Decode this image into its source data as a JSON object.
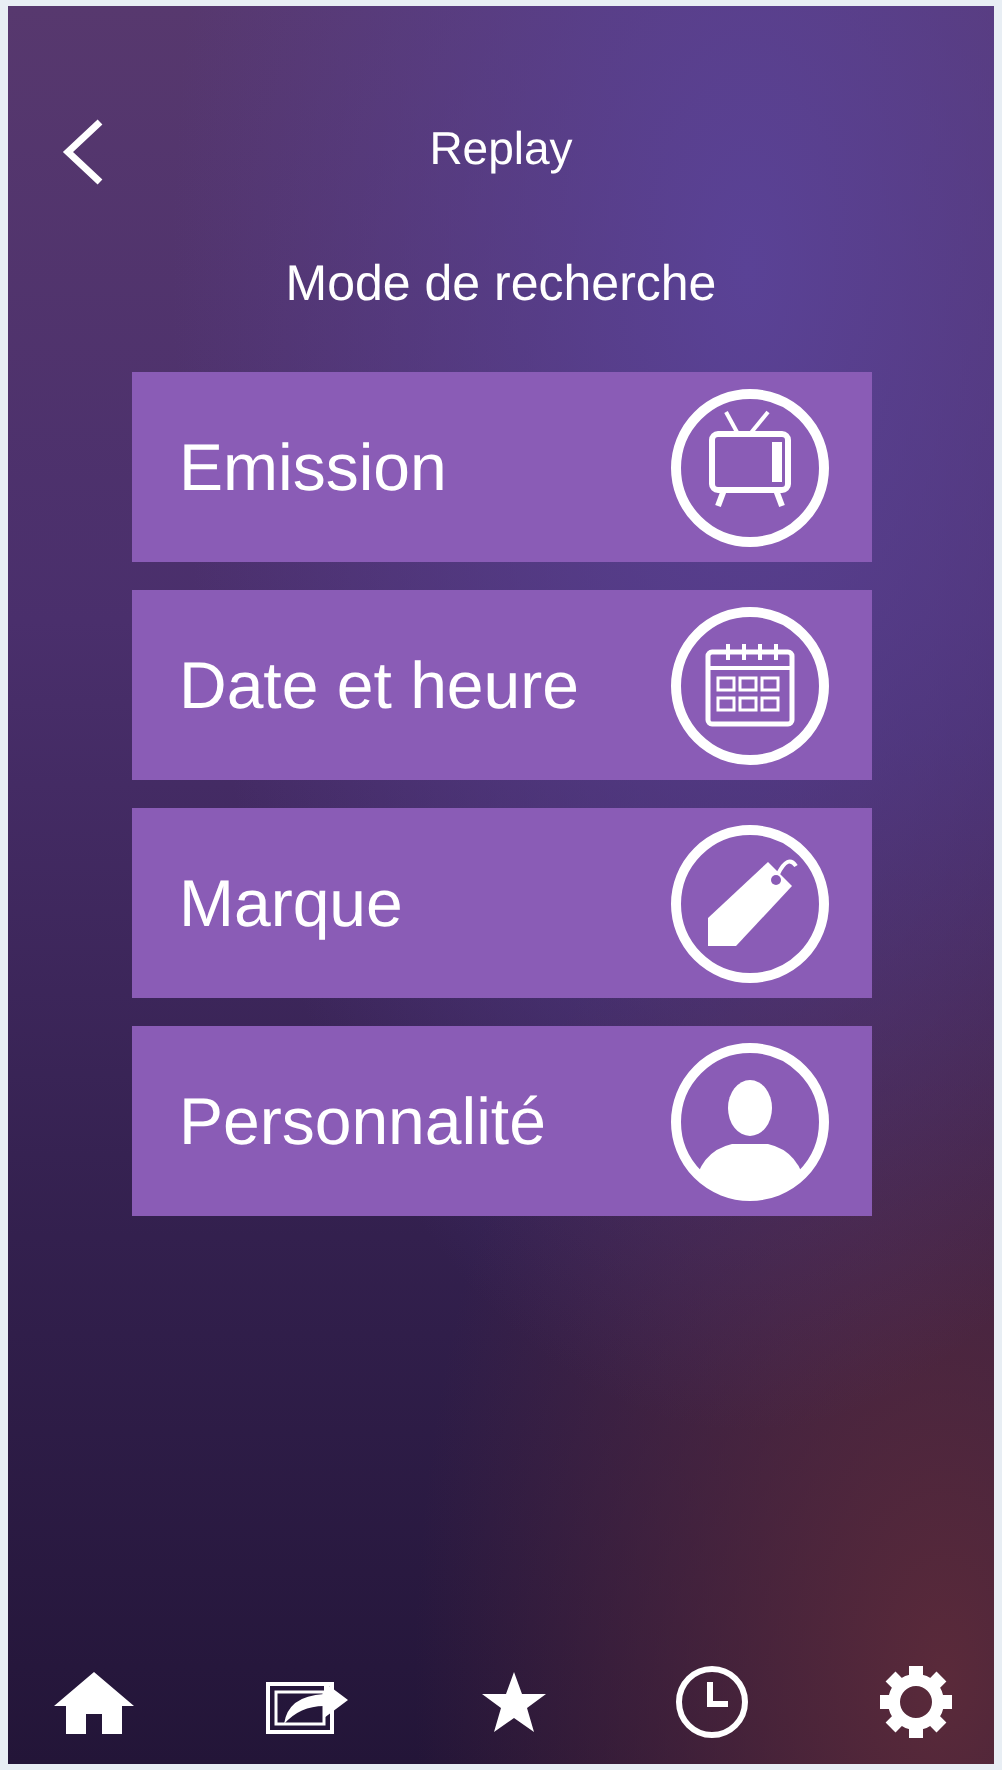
{
  "header": {
    "title": "Replay"
  },
  "subtitle": "Mode de recherche",
  "options": [
    {
      "label": "Emission",
      "kind": "tv"
    },
    {
      "label": "Date et heure",
      "kind": "calendar"
    },
    {
      "label": "Marque",
      "kind": "tag"
    },
    {
      "label": "Personnalité",
      "kind": "person"
    }
  ],
  "tab_bar": [
    {
      "kind": "home"
    },
    {
      "kind": "share"
    },
    {
      "kind": "favorites"
    },
    {
      "kind": "history"
    },
    {
      "kind": "settings"
    }
  ]
}
